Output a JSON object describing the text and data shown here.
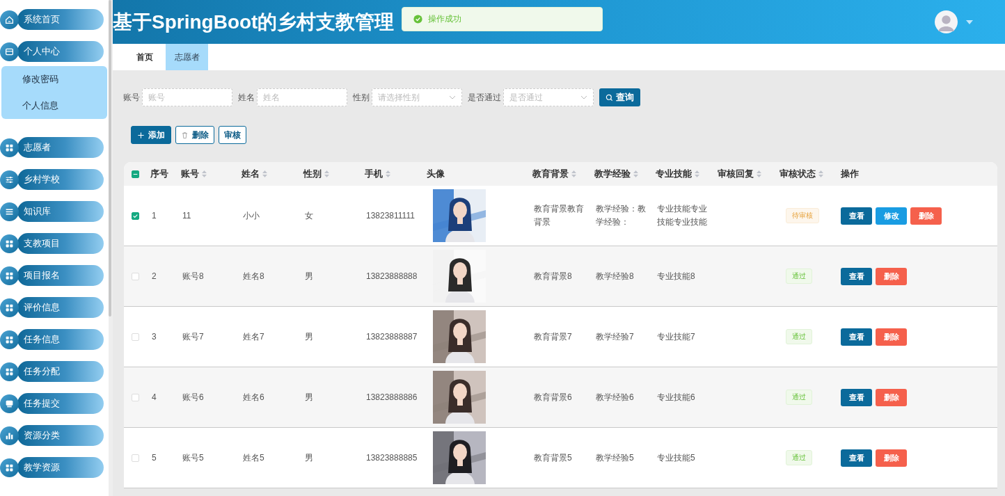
{
  "sidebar": {
    "items": [
      {
        "label": "系统首页"
      },
      {
        "label": "个人中心",
        "children": [
          {
            "label": "修改密码"
          },
          {
            "label": "个人信息"
          }
        ]
      },
      {
        "label": "志愿者"
      },
      {
        "label": "乡村学校"
      },
      {
        "label": "知识库"
      },
      {
        "label": "支教项目"
      },
      {
        "label": "项目报名"
      },
      {
        "label": "评价信息"
      },
      {
        "label": "任务信息"
      },
      {
        "label": "任务分配"
      },
      {
        "label": "任务提交"
      },
      {
        "label": "资源分类"
      },
      {
        "label": "教学资源"
      }
    ]
  },
  "header": {
    "title": "基于SpringBoot的乡村支教管理"
  },
  "toast": {
    "kind": "success",
    "message": "操作成功"
  },
  "tabs": [
    {
      "label": "首页",
      "selected": false
    },
    {
      "label": "志愿者",
      "selected": true
    }
  ],
  "search": {
    "fields": [
      {
        "label": "账号",
        "placeholder": "账号",
        "kind": "input"
      },
      {
        "label": "姓名",
        "placeholder": "姓名",
        "kind": "input"
      },
      {
        "label": "性别",
        "placeholder": "请选择性别",
        "kind": "select"
      },
      {
        "label": "是否通过",
        "placeholder": "是否通过",
        "kind": "select"
      }
    ],
    "button": "查询"
  },
  "toolbar": [
    {
      "label": "添加",
      "kind": "add"
    },
    {
      "label": "删除",
      "kind": "delete"
    },
    {
      "label": "审核",
      "kind": "review"
    }
  ],
  "table": {
    "select_all": {
      "indeterminate": true
    },
    "columns": [
      {
        "label": "序号",
        "sortable": false
      },
      {
        "label": "账号",
        "sortable": true
      },
      {
        "label": "姓名",
        "sortable": true
      },
      {
        "label": "性别",
        "sortable": true
      },
      {
        "label": "手机",
        "sortable": true
      },
      {
        "label": "头像",
        "sortable": false
      },
      {
        "label": "教育背景",
        "sortable": true
      },
      {
        "label": "教学经验",
        "sortable": true
      },
      {
        "label": "专业技能",
        "sortable": true
      },
      {
        "label": "审核回复",
        "sortable": true
      },
      {
        "label": "审核状态",
        "sortable": true
      },
      {
        "label": "操作",
        "sortable": false
      }
    ],
    "rows": [
      {
        "checked": true,
        "index": "1",
        "account": "11",
        "name": "小小",
        "gender": "女",
        "phone": "13823811111",
        "avatar": {
          "kind": "picture"
        },
        "education": "教育背景教育背景",
        "experience": "教学经验：教学经验：",
        "skills": "专业技能专业技能专业技能",
        "status": {
          "label": "待审核",
          "kind": "pending"
        },
        "actions": [
          {
            "label": "查看",
            "kind": "view"
          },
          {
            "label": "修改",
            "kind": "edit"
          },
          {
            "label": "删除",
            "kind": "delete"
          }
        ]
      },
      {
        "checked": false,
        "index": "2",
        "account": "账号8",
        "name": "姓名8",
        "gender": "男",
        "phone": "13823888888",
        "avatar": {
          "kind": "picture"
        },
        "education": "教育背景8",
        "experience": "教学经验8",
        "skills": "专业技能8",
        "status": {
          "label": "通过",
          "kind": "passed"
        },
        "actions": [
          {
            "label": "查看",
            "kind": "view"
          },
          {
            "label": "删除",
            "kind": "delete"
          }
        ]
      },
      {
        "checked": false,
        "index": "3",
        "account": "账号7",
        "name": "姓名7",
        "gender": "男",
        "phone": "13823888887",
        "avatar": {
          "kind": "picture"
        },
        "education": "教育背景7",
        "experience": "教学经验7",
        "skills": "专业技能7",
        "status": {
          "label": "通过",
          "kind": "passed"
        },
        "actions": [
          {
            "label": "查看",
            "kind": "view"
          },
          {
            "label": "删除",
            "kind": "delete"
          }
        ]
      },
      {
        "checked": false,
        "index": "4",
        "account": "账号6",
        "name": "姓名6",
        "gender": "男",
        "phone": "13823888886",
        "avatar": {
          "kind": "picture"
        },
        "education": "教育背景6",
        "experience": "教学经验6",
        "skills": "专业技能6",
        "status": {
          "label": "通过",
          "kind": "passed"
        },
        "actions": [
          {
            "label": "查看",
            "kind": "view"
          },
          {
            "label": "删除",
            "kind": "delete"
          }
        ]
      },
      {
        "checked": false,
        "index": "5",
        "account": "账号5",
        "name": "姓名5",
        "gender": "男",
        "phone": "13823888885",
        "avatar": {
          "kind": "picture"
        },
        "education": "教育背景5",
        "experience": "教学经验5",
        "skills": "专业技能5",
        "status": {
          "label": "通过",
          "kind": "passed"
        },
        "actions": [
          {
            "label": "查看",
            "kind": "view"
          },
          {
            "label": "删除",
            "kind": "delete"
          }
        ]
      }
    ]
  }
}
